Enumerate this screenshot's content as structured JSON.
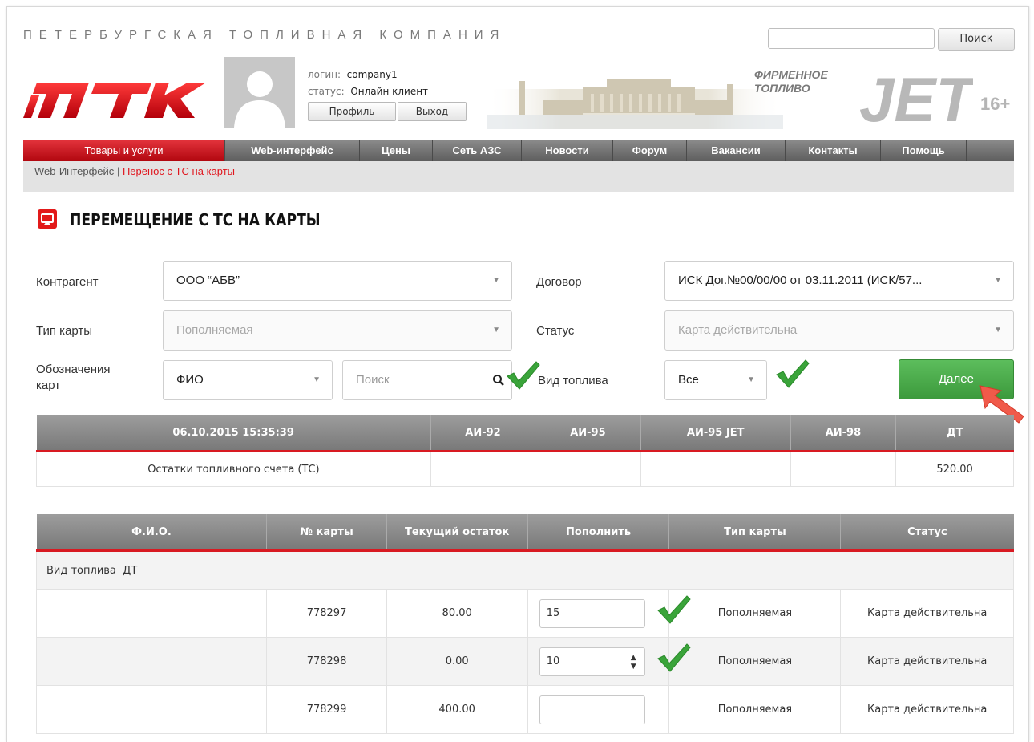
{
  "header": {
    "company_name": "ПЕТЕРБУРГСКАЯ ТОПЛИВНАЯ КОМПАНИЯ",
    "logo_text": "ПТК",
    "login_label": "логин:",
    "login_value": "company1",
    "status_label": "статус:",
    "status_value": "Онлайн клиент",
    "profile_button": "Профиль",
    "logout_button": "Выход",
    "fuel_line1": "ФИРМЕННОЕ",
    "fuel_line2": "ТОПЛИВО",
    "jet_text": "JET",
    "age_rating": "16+",
    "search_placeholder": "",
    "search_button": "Поиск"
  },
  "nav": {
    "items": [
      "Товары и услуги",
      "Web-интерфейс",
      "Цены",
      "Сеть АЗС",
      "Новости",
      "Форум",
      "Вакансии",
      "Контакты",
      "Помощь"
    ]
  },
  "breadcrumb": {
    "parent": "Web-Интерфейс",
    "separator": "|",
    "current": "Перенос с ТС на карты"
  },
  "page_title": "ПЕРЕМЕЩЕНИЕ С ТС НА КАРТЫ",
  "form": {
    "contractor_label": "Контрагент",
    "contractor_value": "ООО “АБВ”",
    "contract_label": "Договор",
    "contract_value": "ИСК Дог.№00/00/00 от 03.11.2011 (ИСК/57...",
    "card_type_label": "Тип карты",
    "card_type_value": "Пополняемая",
    "status_label": "Статус",
    "status_value": "Карта действительна",
    "card_marks_label_1": "Обозначения",
    "card_marks_label_2": "карт",
    "card_marks_value": "ФИО",
    "search_placeholder": "Поиск",
    "fuel_type_label": "Вид топлива",
    "fuel_type_value": "Все",
    "next_button": "Далее"
  },
  "balance_table": {
    "headers": [
      "06.10.2015 15:35:39",
      "АИ-92",
      "АИ-95",
      "АИ-95 JET",
      "АИ-98",
      "ДТ"
    ],
    "row": [
      "Остатки топливного счета (ТС)",
      "",
      "",
      "",
      "",
      "520.00"
    ]
  },
  "cards_table": {
    "headers": [
      "Ф.И.О.",
      "№ карты",
      "Текущий остаток",
      "Пополнить",
      "Тип карты",
      "Статус"
    ],
    "group_label": "Вид топлива  ДТ",
    "rows": [
      {
        "fio": "",
        "card_no": "778297",
        "balance": "80.00",
        "topup": "15",
        "card_type": "Пополняемая",
        "status": "Карта действительна"
      },
      {
        "fio": "",
        "card_no": "778298",
        "balance": "0.00",
        "topup": "10",
        "card_type": "Пополняемая",
        "status": "Карта действительна"
      },
      {
        "fio": "",
        "card_no": "778299",
        "balance": "400.00",
        "topup": "",
        "card_type": "Пополняемая",
        "status": "Карта действительна"
      }
    ]
  },
  "colors": {
    "accent_red": "#e0161e",
    "next_green": "#48a848",
    "check_green": "#3aa43a"
  }
}
